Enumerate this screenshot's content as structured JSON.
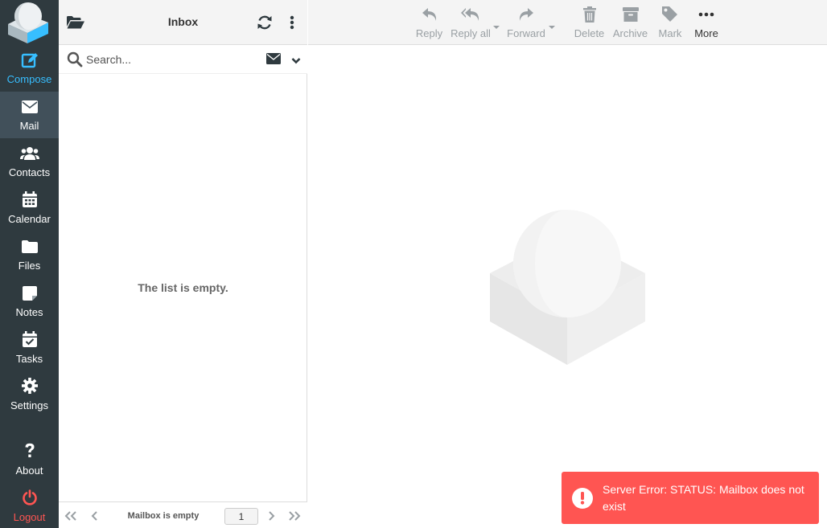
{
  "colors": {
    "sidebar_bg": "#2f3a3f",
    "sidebar_active_bg": "#41505a",
    "accent": "#37beff",
    "danger": "#ff5552",
    "toolbar_bg": "#f4f4f4"
  },
  "nav": {
    "compose": "Compose",
    "mail": "Mail",
    "contacts": "Contacts",
    "calendar": "Calendar",
    "files": "Files",
    "notes": "Notes",
    "tasks": "Tasks",
    "settings": "Settings",
    "about": "About",
    "logout": "Logout"
  },
  "list": {
    "title": "Inbox",
    "search_placeholder": "Search...",
    "empty_message": "The list is empty.",
    "footer_status": "Mailbox is empty",
    "page_number": "1"
  },
  "toolbar": {
    "reply": "Reply",
    "reply_all": "Reply all",
    "forward": "Forward",
    "delete": "Delete",
    "archive": "Archive",
    "mark": "Mark",
    "more": "More"
  },
  "toast": {
    "message": "Server Error: STATUS: Mailbox does not exist"
  },
  "icons": {
    "compose": "edit-icon",
    "mail": "envelope-icon",
    "contacts": "users-icon",
    "calendar": "calendar-icon",
    "files": "folder-icon",
    "notes": "sticky-note-icon",
    "tasks": "calendar-check-icon",
    "settings": "gear-icon",
    "about": "question-icon",
    "logout": "power-icon"
  }
}
